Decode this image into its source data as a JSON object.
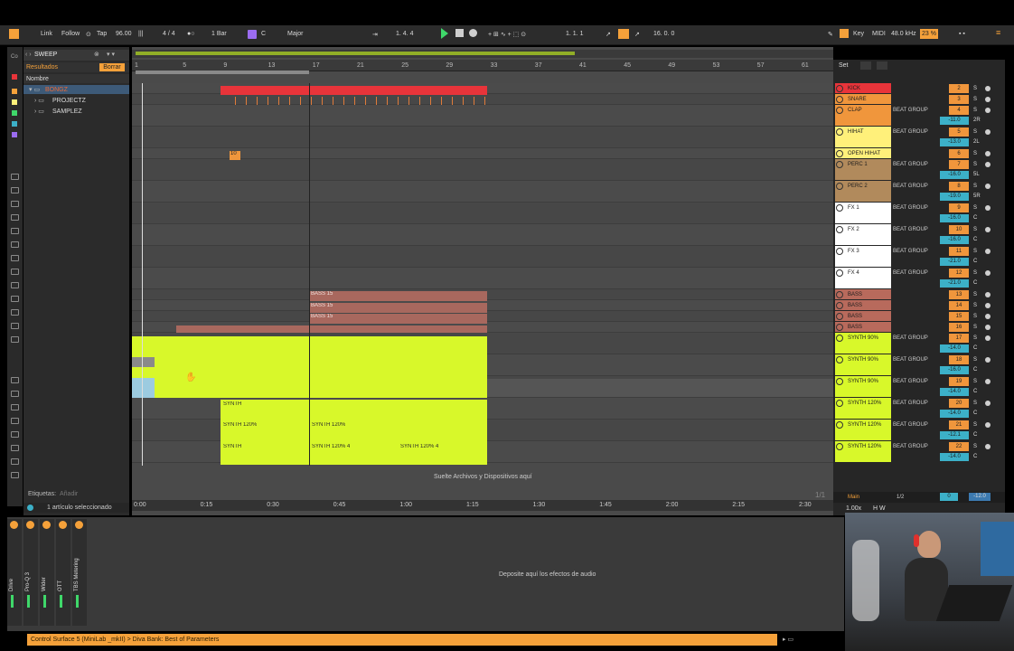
{
  "transport": {
    "link": "Link",
    "follow": "Follow",
    "tap": "Tap",
    "tempo": "96.00",
    "signature": "4 / 4",
    "quantize": "1 Bar",
    "key_root": "C",
    "scale": "Major",
    "position": "1.  4.  4",
    "loop_start": "1.  1.  1",
    "loop_length": "16.  0.  0",
    "key_label": "Key",
    "midi_label": "MIDI",
    "sample_rate": "48.0 kHz",
    "cpu": "23 %"
  },
  "browser": {
    "search_value": "SWEEP",
    "results_label": "Resultados",
    "clear_label": "Borrar",
    "column_header": "Nombre",
    "items": [
      "BONGZ",
      "PROJECTZ",
      "SAMPLEZ"
    ],
    "tags_label": "Etiquetas:",
    "tags_add": "Añadir",
    "selection_status": "1 artículo seleccionado"
  },
  "ruler": [
    "1",
    "5",
    "9",
    "13",
    "17",
    "21",
    "25",
    "29",
    "33",
    "37",
    "41",
    "45",
    "49",
    "53",
    "57",
    "61"
  ],
  "timeline": [
    "0:00",
    "0:15",
    "0:30",
    "0:45",
    "1:00",
    "1:15",
    "1:30",
    "1:45",
    "2:00",
    "2:15",
    "2:30"
  ],
  "clips": {
    "bass": "BASS 15",
    "small_badge": "10",
    "synth": "SYNTH",
    "synth120": "SYNTH 120%",
    "synth120_4": "SYNTH 120% 4"
  },
  "drop_hint": "Suelte Archivos y Dispositivos aquí",
  "page_indicator": "1/1",
  "set_label": "Set",
  "tracks": [
    {
      "name": "KICK",
      "color": "#e8343a",
      "route": "",
      "num": "2",
      "vol": "",
      "pan": ""
    },
    {
      "name": "SNARE",
      "color": "#f0963c",
      "route": "",
      "num": "3",
      "vol": "",
      "pan": ""
    },
    {
      "name": "CLAP",
      "color": "#f0963c",
      "route": "BEAT GROUP",
      "num": "4",
      "vol": "-11.0",
      "pan": "2R"
    },
    {
      "name": "HIHAT",
      "color": "#fff07a",
      "route": "BEAT GROUP",
      "num": "5",
      "vol": "-13.0",
      "pan": "2L"
    },
    {
      "name": "OPEN HIHAT",
      "color": "#fff07a",
      "route": "",
      "num": "6",
      "vol": "",
      "pan": ""
    },
    {
      "name": "PERC 1",
      "color": "#b18a5c",
      "route": "BEAT GROUP",
      "num": "7",
      "vol": "-16.0",
      "pan": "5L"
    },
    {
      "name": "PERC 2",
      "color": "#b18a5c",
      "route": "BEAT GROUP",
      "num": "8",
      "vol": "-19.0",
      "pan": "5R"
    },
    {
      "name": "FX 1",
      "color": "#ffffff",
      "route": "BEAT GROUP",
      "num": "9",
      "vol": "-16.0",
      "pan": "C"
    },
    {
      "name": "FX 2",
      "color": "#ffffff",
      "route": "BEAT GROUP",
      "num": "10",
      "vol": "-16.0",
      "pan": "C"
    },
    {
      "name": "FX 3",
      "color": "#ffffff",
      "route": "BEAT GROUP",
      "num": "11",
      "vol": "-21.0",
      "pan": "C"
    },
    {
      "name": "FX 4",
      "color": "#ffffff",
      "route": "BEAT GROUP",
      "num": "12",
      "vol": "-21.0",
      "pan": "C"
    },
    {
      "name": "BASS",
      "color": "#b86a5c",
      "route": "",
      "num": "13",
      "vol": "",
      "pan": ""
    },
    {
      "name": "BASS",
      "color": "#b86a5c",
      "route": "",
      "num": "14",
      "vol": "",
      "pan": ""
    },
    {
      "name": "BASS",
      "color": "#b86a5c",
      "route": "",
      "num": "15",
      "vol": "",
      "pan": ""
    },
    {
      "name": "BASS",
      "color": "#b86a5c",
      "route": "",
      "num": "16",
      "vol": "",
      "pan": ""
    },
    {
      "name": "SYNTH 90%",
      "color": "#d8f82a",
      "route": "BEAT GROUP",
      "num": "17",
      "vol": "-14.0",
      "pan": "C"
    },
    {
      "name": "SYNTH 90%",
      "color": "#d8f82a",
      "route": "BEAT GROUP",
      "num": "18",
      "vol": "-16.0",
      "pan": "C"
    },
    {
      "name": "SYNTH 90%",
      "color": "#d8f82a",
      "route": "BEAT GROUP",
      "num": "19",
      "vol": "-14.0",
      "pan": "C"
    },
    {
      "name": "SYNTH 120%",
      "color": "#d8f82a",
      "route": "BEAT GROUP",
      "num": "20",
      "vol": "-14.0",
      "pan": "C"
    },
    {
      "name": "SYNTH 120%",
      "color": "#d8f82a",
      "route": "BEAT GROUP",
      "num": "21",
      "vol": "-12.1",
      "pan": "C"
    },
    {
      "name": "SYNTH 120%",
      "color": "#d8f82a",
      "route": "BEAT GROUP",
      "num": "22",
      "vol": "-14.0",
      "pan": "C"
    }
  ],
  "main": {
    "name": "Main",
    "route": "1/2",
    "vol": "0",
    "vol2": "-12.0"
  },
  "devices": [
    "Drive",
    "Pro-Q 3",
    "Wider",
    "OTT",
    "TBS Metering"
  ],
  "device_drop_hint": "Deposite aquí los efectos de audio",
  "status_text": "Control Surface 5 (MiniLab _mkII) > Diva Bank: Best of Parameters",
  "zoom": "1.00x",
  "colors": {
    "accent": "#f5a13a",
    "synth": "#d8f82a",
    "kick": "#e8343a",
    "bass_clip": "#a8685e"
  }
}
